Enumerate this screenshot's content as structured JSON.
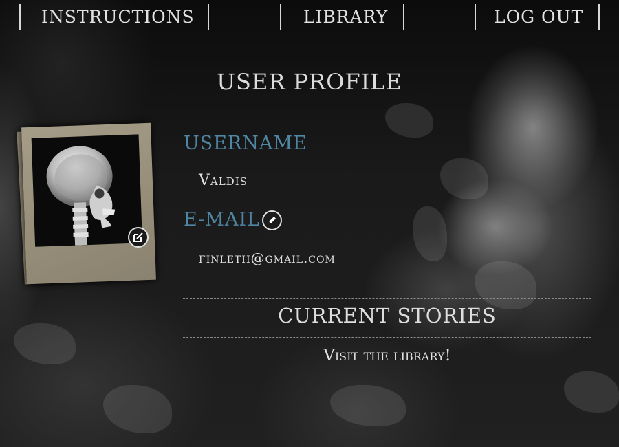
{
  "nav": {
    "instructions": "INSTRUCTIONS",
    "library": "LIBRARY",
    "logout": "LOG OUT"
  },
  "page": {
    "title": "USER PROFILE"
  },
  "profile": {
    "avatar_icon": "skull-xray-photo",
    "edit_avatar_icon": "edit-external-icon",
    "username_label": "USERNAME",
    "username_value": "Valdis",
    "email_label": "E-MAIL",
    "email_edit_icon": "pencil-icon",
    "email_value": "finleth@gmail.com"
  },
  "stories": {
    "title": "CURRENT STORIES",
    "library_link": "Visit the library!"
  },
  "colors": {
    "label_accent": "#4f86a3",
    "text": "#e0e0e0",
    "background": "#141414"
  }
}
